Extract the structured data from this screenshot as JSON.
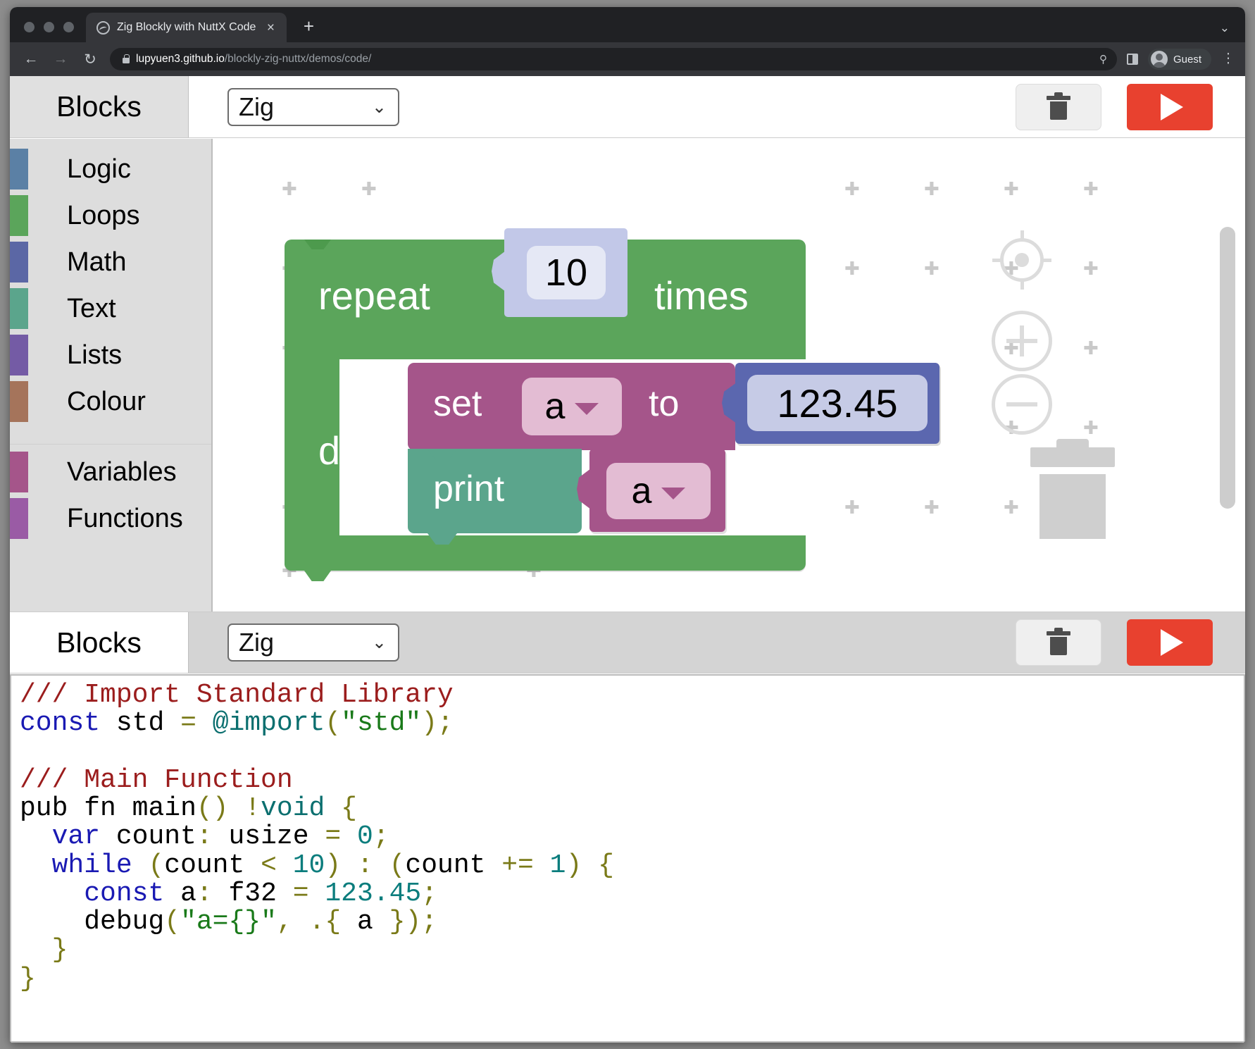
{
  "browser": {
    "tab": {
      "title": "Zig Blockly with NuttX Code",
      "close_label": "×",
      "favicon": "globe-icon"
    },
    "new_tab_label": "+",
    "tabstrip_chevron": "⌄",
    "nav": {
      "back": "←",
      "forward": "→",
      "reload": "↻"
    },
    "omnibox": {
      "host": "lupyuen3.github.io",
      "path": "/blockly-zig-nuttx/demos/code/",
      "zoom_icon": "zoom-search-icon",
      "split_icon": "split-view-icon"
    },
    "profile": {
      "label": "Guest"
    },
    "menu_label": "⋮"
  },
  "toolbar_top": {
    "tab_label": "Blocks",
    "language": {
      "value": "Zig",
      "chevron": "⌄"
    },
    "trash_title": "Delete Blocks",
    "run_title": "Run Program"
  },
  "toolbar_bottom": {
    "tab_label": "Blocks",
    "language": {
      "value": "Zig",
      "chevron": "⌄"
    },
    "trash_title": "Delete Blocks",
    "run_title": "Run Program"
  },
  "toolbox": {
    "categories": [
      {
        "label": "Logic",
        "colour": "#5b80a5"
      },
      {
        "label": "Loops",
        "colour": "#5ba55b"
      },
      {
        "label": "Math",
        "colour": "#5b67a5"
      },
      {
        "label": "Text",
        "colour": "#5ba58c"
      },
      {
        "label": "Lists",
        "colour": "#745ba5"
      },
      {
        "label": "Colour",
        "colour": "#a5745b"
      }
    ],
    "categories2": [
      {
        "label": "Variables",
        "colour": "#a5558a"
      },
      {
        "label": "Functions",
        "colour": "#9a5ba5"
      }
    ]
  },
  "workspace": {
    "blocks": {
      "repeat": {
        "label": "repeat",
        "count": "10",
        "times_label": "times",
        "do_label": "do",
        "colour": "#5ba55b"
      },
      "set": {
        "label": "set",
        "variable": "a",
        "to_label": "to",
        "colour": "#a5558a"
      },
      "number": {
        "value": "123.45",
        "colour": "#5b67af"
      },
      "print": {
        "label": "print",
        "colour": "#5ba58c"
      },
      "print_variable": {
        "variable": "a",
        "colour": "#a5558a"
      }
    },
    "controls": {
      "center_icon": "center-target-icon",
      "zoom_in_icon": "zoom-in-icon",
      "zoom_out_icon": "zoom-out-icon",
      "trash_icon": "trashcan-icon",
      "scrollbar": "vertical-scrollbar"
    }
  },
  "code": {
    "language": "Zig",
    "lines": [
      "/// Import Standard Library",
      "const std = @import(\"std\");",
      "",
      "/// Main Function",
      "pub fn main() !void {",
      "  var count: usize = 0;",
      "  while (count < 10) : (count += 1) {",
      "    const a: f32 = 123.45;",
      "    debug(\"a={}\", .{ a });",
      "  }",
      "}"
    ]
  }
}
